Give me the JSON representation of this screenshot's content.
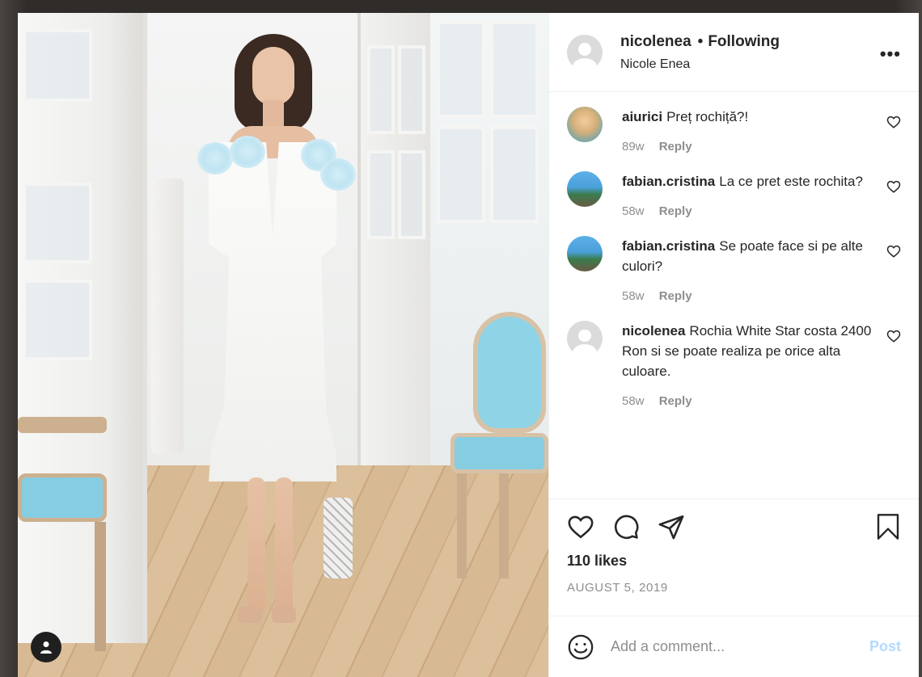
{
  "post_author": {
    "username": "nicolenea",
    "separator": "•",
    "follow_status": "Following",
    "full_name": "Nicole Enea",
    "more_label": "•••"
  },
  "comments": [
    {
      "username": "aiurici",
      "text": "Preț rochiță?!",
      "age": "89w",
      "reply_label": "Reply",
      "avatar_icon": "user-photo"
    },
    {
      "username": "fabian.cristina",
      "text": "La ce pret este rochita?",
      "age": "58w",
      "reply_label": "Reply",
      "avatar_icon": "user-photo"
    },
    {
      "username": "fabian.cristina",
      "text": "Se poate face si pe alte culori?",
      "age": "58w",
      "reply_label": "Reply",
      "avatar_icon": "user-photo"
    },
    {
      "username": "nicolenea",
      "text": "Rochia White Star costa 2400 Ron si se poate realiza pe orice alta culoare.",
      "age": "58w",
      "reply_label": "Reply",
      "avatar_icon": "default-avatar"
    }
  ],
  "actions": {
    "icons": [
      "heart-icon",
      "comment-icon",
      "share-icon",
      "bookmark-icon"
    ],
    "likes": "110 likes",
    "date": "AUGUST 5, 2019"
  },
  "add_comment": {
    "placeholder": "Add a comment...",
    "post_label": "Post",
    "post_color": "#b3dbff"
  },
  "colors": {
    "text_primary": "#262626",
    "text_secondary": "#8e8e8e",
    "border": "#efefef"
  }
}
